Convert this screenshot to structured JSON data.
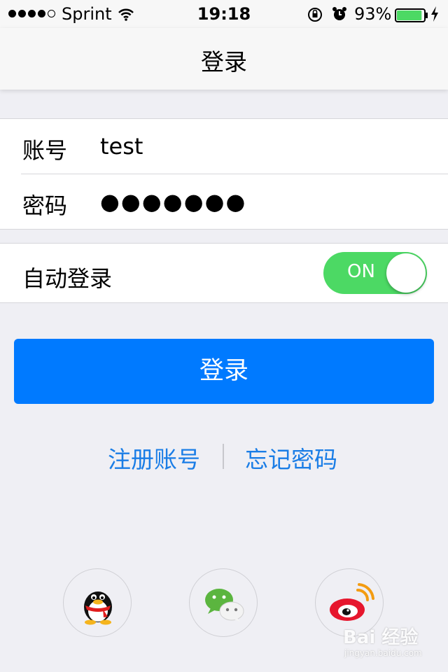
{
  "status_bar": {
    "carrier": "Sprint",
    "time": "19:18",
    "battery_percent": "93%",
    "battery_level": 0.93,
    "icons": [
      "signal-dots",
      "wifi-icon",
      "orientation-lock-icon",
      "alarm-icon",
      "battery-icon",
      "charging-bolt-icon"
    ]
  },
  "nav": {
    "title": "登录"
  },
  "form": {
    "account_label": "账号",
    "account_value": "test",
    "password_label": "密码",
    "password_value": "●●●●●●●",
    "auto_login_label": "自动登录",
    "auto_login_toggle": "ON"
  },
  "login_button": "登录",
  "links": {
    "register": "注册账号",
    "separator": "|",
    "forgot": "忘记密码"
  },
  "social": [
    "qq-icon",
    "wechat-icon",
    "weibo-icon"
  ],
  "watermark": {
    "main": "Bai 经验",
    "sub": "jingyan.baidu.com"
  },
  "colors": {
    "accent": "#007aff",
    "link": "#1a7de6",
    "toggle_on": "#4cd964",
    "background": "#efeff4"
  }
}
